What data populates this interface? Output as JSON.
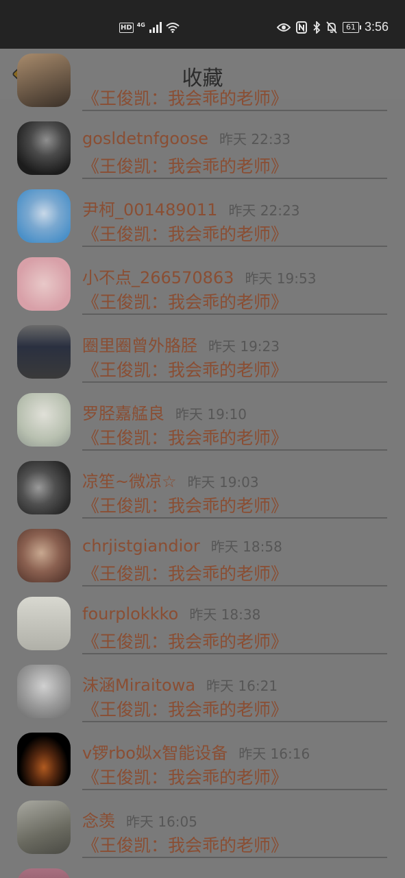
{
  "status_bar": {
    "hd": "HD",
    "network": "4G",
    "battery": "61",
    "time": "3:56"
  },
  "header": {
    "title": "收藏"
  },
  "items": [
    {
      "title": "《王俊凯：我会乖的老师》",
      "avatar_colors": [
        "#3a3028",
        "#a88b6c"
      ]
    },
    {
      "name": "gosldetnfgoose",
      "time": "昨天 22:33",
      "title": "《王俊凯：我会乖的老师》",
      "avatar_colors": [
        "#1c1c1c",
        "#8f8f8f"
      ]
    },
    {
      "name": "尹柯_001489011",
      "time": "昨天 22:23",
      "title": "《王俊凯：我会乖的老师》",
      "avatar_colors": [
        "#4a90c8",
        "#c8d8e8"
      ]
    },
    {
      "name": "小不点_266570863",
      "time": "昨天 19:53",
      "title": "《王俊凯：我会乖的老师》",
      "avatar_colors": [
        "#d8a0a8",
        "#e8c8c8"
      ]
    },
    {
      "name": "圈里圈曾外胳胫",
      "time": "昨天 19:23",
      "title": "《王俊凯：我会乖的老师》",
      "avatar_colors": [
        "#2a3040",
        "#6a6a6a"
      ]
    },
    {
      "name": "罗胫嘉艋良",
      "time": "昨天 19:10",
      "title": "《王俊凯：我会乖的老师》",
      "avatar_colors": [
        "#b8c0b0",
        "#e0e0d8"
      ]
    },
    {
      "name": "凉笙~微凉☆",
      "time": "昨天 19:03",
      "title": "《王俊凯：我会乖的老师》",
      "avatar_colors": [
        "#282828",
        "#9a9a9a"
      ]
    },
    {
      "name": "chrjistgiandior",
      "time": "昨天 18:58",
      "title": "《王俊凯：我会乖的老师》",
      "avatar_colors": [
        "#5a3a30",
        "#c8a890"
      ]
    },
    {
      "name": "fourplokkko",
      "time": "昨天 18:38",
      "title": "《王俊凯：我会乖的老师》",
      "avatar_colors": [
        "#b0b0a8",
        "#d8d8d0"
      ]
    },
    {
      "name": "沫涵Miraitowa",
      "time": "昨天 16:21",
      "title": "《王俊凯：我会乖的老师》",
      "avatar_colors": [
        "#8a8a8a",
        "#d0d0d0"
      ]
    },
    {
      "name": "v锣rbo姒x智能设备",
      "time": "昨天 16:16",
      "title": "《王俊凯：我会乖的老师》",
      "avatar_colors": [
        "#000000",
        "#b05a20"
      ]
    },
    {
      "name": "念羡",
      "time": "昨天 16:05",
      "title": "《王俊凯：我会乖的老师》",
      "avatar_colors": [
        "#6a6a60",
        "#a8a8a0"
      ]
    },
    {
      "avatar_colors": [
        "#6a3a4a",
        "#a87080"
      ]
    }
  ]
}
